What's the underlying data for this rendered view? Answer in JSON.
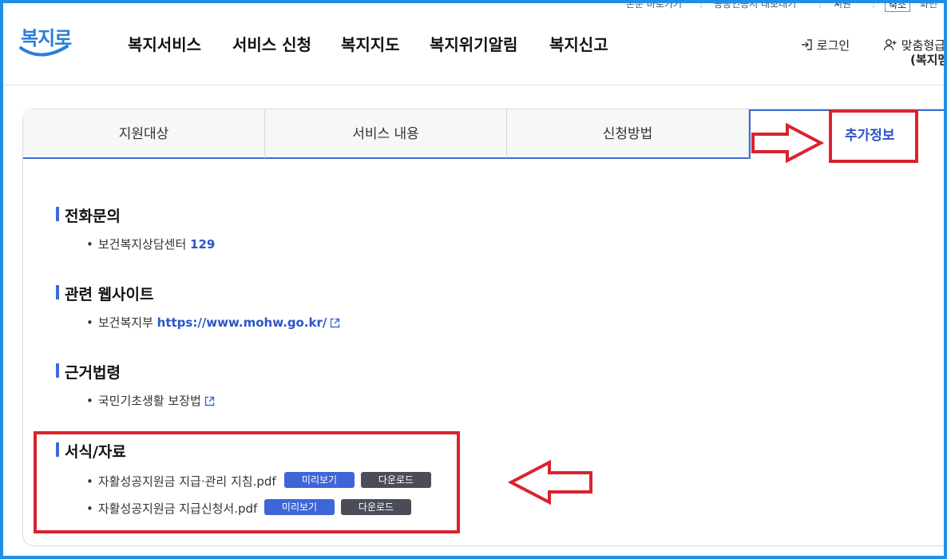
{
  "util_bar": {
    "items": [
      "본문 바로가기",
      "공동인증서 내보내기",
      "지원",
      "축소",
      "화면"
    ],
    "chevron": "chevron-down-icon"
  },
  "logo": {
    "text": "복지로"
  },
  "gnb": [
    "복지서비스",
    "서비스 신청",
    "복지지도",
    "복지위기알림",
    "복지신고"
  ],
  "header": {
    "login": "로그인",
    "custom_line1": "맞춤형급",
    "custom_line2": "(복지멤"
  },
  "tabs": [
    {
      "label": "지원대상",
      "active": false
    },
    {
      "label": "서비스 내용",
      "active": false
    },
    {
      "label": "신청방법",
      "active": false
    },
    {
      "label": "추가정보",
      "active": true
    }
  ],
  "sections": {
    "phone": {
      "title": "전화문의",
      "item_label": "보건복지상담센터",
      "item_value": "129"
    },
    "website": {
      "title": "관련 웹사이트",
      "item_label": "보건복지부",
      "item_link": "https://www.mohw.go.kr/"
    },
    "law": {
      "title": "근거법령",
      "item_label": "국민기초생활 보장법"
    },
    "forms": {
      "title": "서식/자료",
      "files": [
        {
          "name": "자활성공지원금 지급·관리 지침.pdf",
          "preview": "미리보기",
          "download": "다운로드"
        },
        {
          "name": "자활성공지원금 지급신청서.pdf",
          "preview": "미리보기",
          "download": "다운로드"
        }
      ]
    }
  },
  "colors": {
    "accent": "#3d6ad6",
    "annotation": "#d9232e",
    "frame": "#1e8fe6",
    "download_button": "#4a4d57"
  }
}
